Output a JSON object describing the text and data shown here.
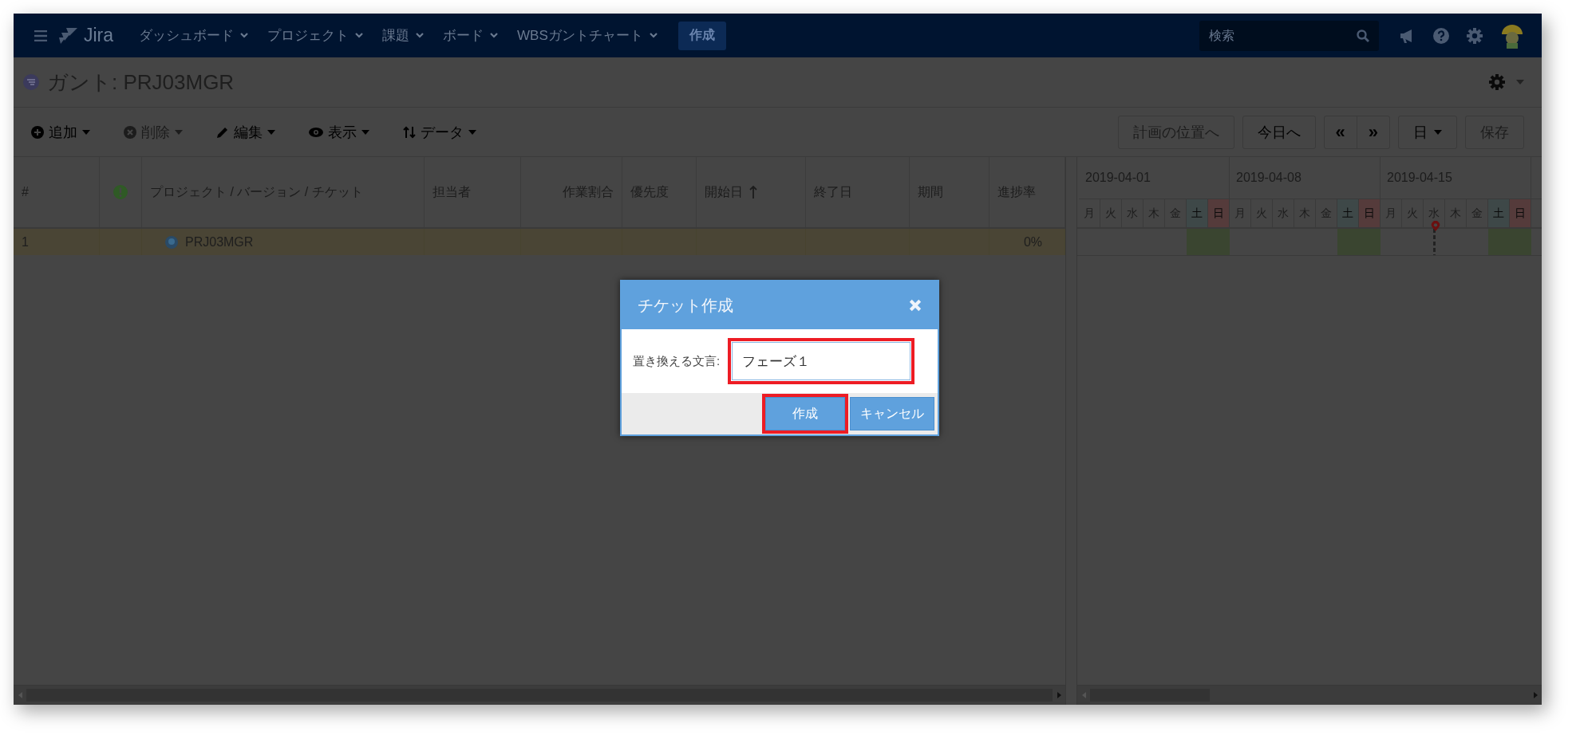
{
  "nav": {
    "logo": "Jira",
    "menu_items": [
      {
        "label": "ダッシュボード"
      },
      {
        "label": "プロジェクト"
      },
      {
        "label": "課題"
      },
      {
        "label": "ボード"
      },
      {
        "label": "WBSガントチャート"
      }
    ],
    "create_button": "作成",
    "search": {
      "placeholder": "検索"
    }
  },
  "page": {
    "title": "ガント: PRJ03MGR"
  },
  "toolbar": {
    "left": [
      {
        "label": "追加",
        "kind": "add",
        "disabled": false
      },
      {
        "label": "削除",
        "kind": "delete",
        "disabled": true
      },
      {
        "label": "編集",
        "kind": "edit",
        "disabled": false
      },
      {
        "label": "表示",
        "kind": "view",
        "disabled": false
      },
      {
        "label": "データ",
        "kind": "data",
        "disabled": false
      }
    ],
    "right": [
      {
        "label": "計画の位置へ",
        "kind": "button",
        "disabled": true
      },
      {
        "label": "今日へ",
        "kind": "button",
        "disabled": false
      },
      {
        "label": "«",
        "kind": "pager-left",
        "disabled": false
      },
      {
        "label": "»",
        "kind": "pager-right",
        "disabled": false
      },
      {
        "label": "日",
        "kind": "dropdown",
        "disabled": false
      },
      {
        "label": "保存",
        "kind": "button",
        "disabled": true
      }
    ]
  },
  "table": {
    "columns": [
      {
        "label": "#",
        "kind": "text"
      },
      {
        "kind": "alert"
      },
      {
        "label": "プロジェクト / バージョン / チケット",
        "kind": "text"
      },
      {
        "label": "担当者",
        "kind": "text"
      },
      {
        "label": "作業割合",
        "kind": "text"
      },
      {
        "label": "優先度",
        "kind": "text"
      },
      {
        "label": "開始日",
        "kind": "sorted"
      },
      {
        "label": "終了日",
        "kind": "text"
      },
      {
        "label": "期間",
        "kind": "text"
      },
      {
        "label": "進捗率",
        "kind": "text"
      }
    ],
    "rows": [
      {
        "number": "1",
        "name": "PRJ03MGR",
        "progress": "0%",
        "selected": true
      }
    ]
  },
  "gantt": {
    "weeks": [
      "2019-04-01",
      "2019-04-08",
      "2019-04-15"
    ],
    "days": [
      {
        "label": "月",
        "kind": "weekday",
        "today": false
      },
      {
        "label": "火",
        "kind": "weekday",
        "today": false
      },
      {
        "label": "水",
        "kind": "weekday",
        "today": false
      },
      {
        "label": "木",
        "kind": "weekday",
        "today": false
      },
      {
        "label": "金",
        "kind": "weekday",
        "today": false
      },
      {
        "label": "土",
        "kind": "saturday",
        "today": false
      },
      {
        "label": "日",
        "kind": "sunday",
        "today": false
      },
      {
        "label": "月",
        "kind": "weekday",
        "today": false
      },
      {
        "label": "火",
        "kind": "weekday",
        "today": false
      },
      {
        "label": "水",
        "kind": "weekday",
        "today": false
      },
      {
        "label": "木",
        "kind": "weekday",
        "today": false
      },
      {
        "label": "金",
        "kind": "weekday",
        "today": false
      },
      {
        "label": "土",
        "kind": "saturday",
        "today": false
      },
      {
        "label": "日",
        "kind": "sunday",
        "today": false
      },
      {
        "label": "月",
        "kind": "weekday",
        "today": false
      },
      {
        "label": "火",
        "kind": "weekday",
        "today": false
      },
      {
        "label": "水",
        "kind": "weekday",
        "today": true
      },
      {
        "label": "木",
        "kind": "weekday",
        "today": false
      },
      {
        "label": "金",
        "kind": "weekday",
        "today": false
      },
      {
        "label": "土",
        "kind": "saturday",
        "today": false
      },
      {
        "label": "日",
        "kind": "sunday",
        "today": false
      }
    ]
  },
  "dialog": {
    "title": "チケット作成",
    "field_label": "置き換える文言:",
    "field_value": "フェーズ１",
    "field_highlighted": true,
    "buttons": [
      {
        "label": "作成",
        "kind": "primary",
        "highlighted": true
      },
      {
        "label": "キャンセル",
        "kind": "secondary",
        "highlighted": false
      }
    ]
  }
}
